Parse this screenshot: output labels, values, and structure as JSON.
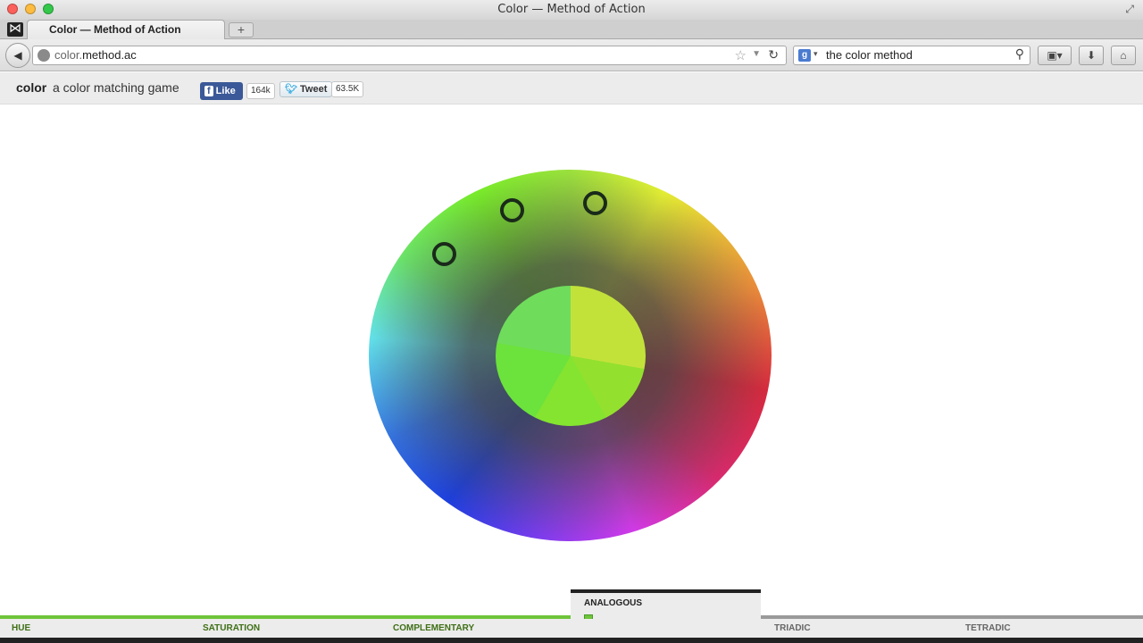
{
  "window": {
    "title": "Color — Method of Action"
  },
  "tab": {
    "title": "Color — Method of Action",
    "new_tab": "+"
  },
  "navbar": {
    "back": "◀",
    "url_host_prefix": "color.",
    "url_host_main": "method.ac",
    "star": "☆",
    "url_dropdown": "▼",
    "reload": "↻",
    "search_engine_icon": "g",
    "search_dropdown": "▾",
    "search_query": "the color method",
    "search_icon": "⚲",
    "bookmarks": "▣▾",
    "download": "⬇",
    "home": "⌂"
  },
  "header": {
    "brand": "color",
    "tagline": "a color matching game",
    "fb_like_label": "Like",
    "fb_count": "164k",
    "tweet_label": "Tweet",
    "tweet_count": "63.5K"
  },
  "game": {
    "current_step": "ANALOGOUS",
    "progress_fraction": 0.5,
    "colors": {
      "accent": "#6fc43a",
      "done_text": "#3f6f16",
      "swatch": "#84e430"
    }
  },
  "steps": [
    {
      "label": "HUE",
      "status": "done"
    },
    {
      "label": "SATURATION",
      "status": "done"
    },
    {
      "label": "COMPLEMENTARY",
      "status": "done"
    },
    {
      "label": "ANALOGOUS",
      "status": "active"
    },
    {
      "label": "TRIADIC",
      "status": "todo"
    },
    {
      "label": "TETRADIC",
      "status": "todo"
    }
  ]
}
